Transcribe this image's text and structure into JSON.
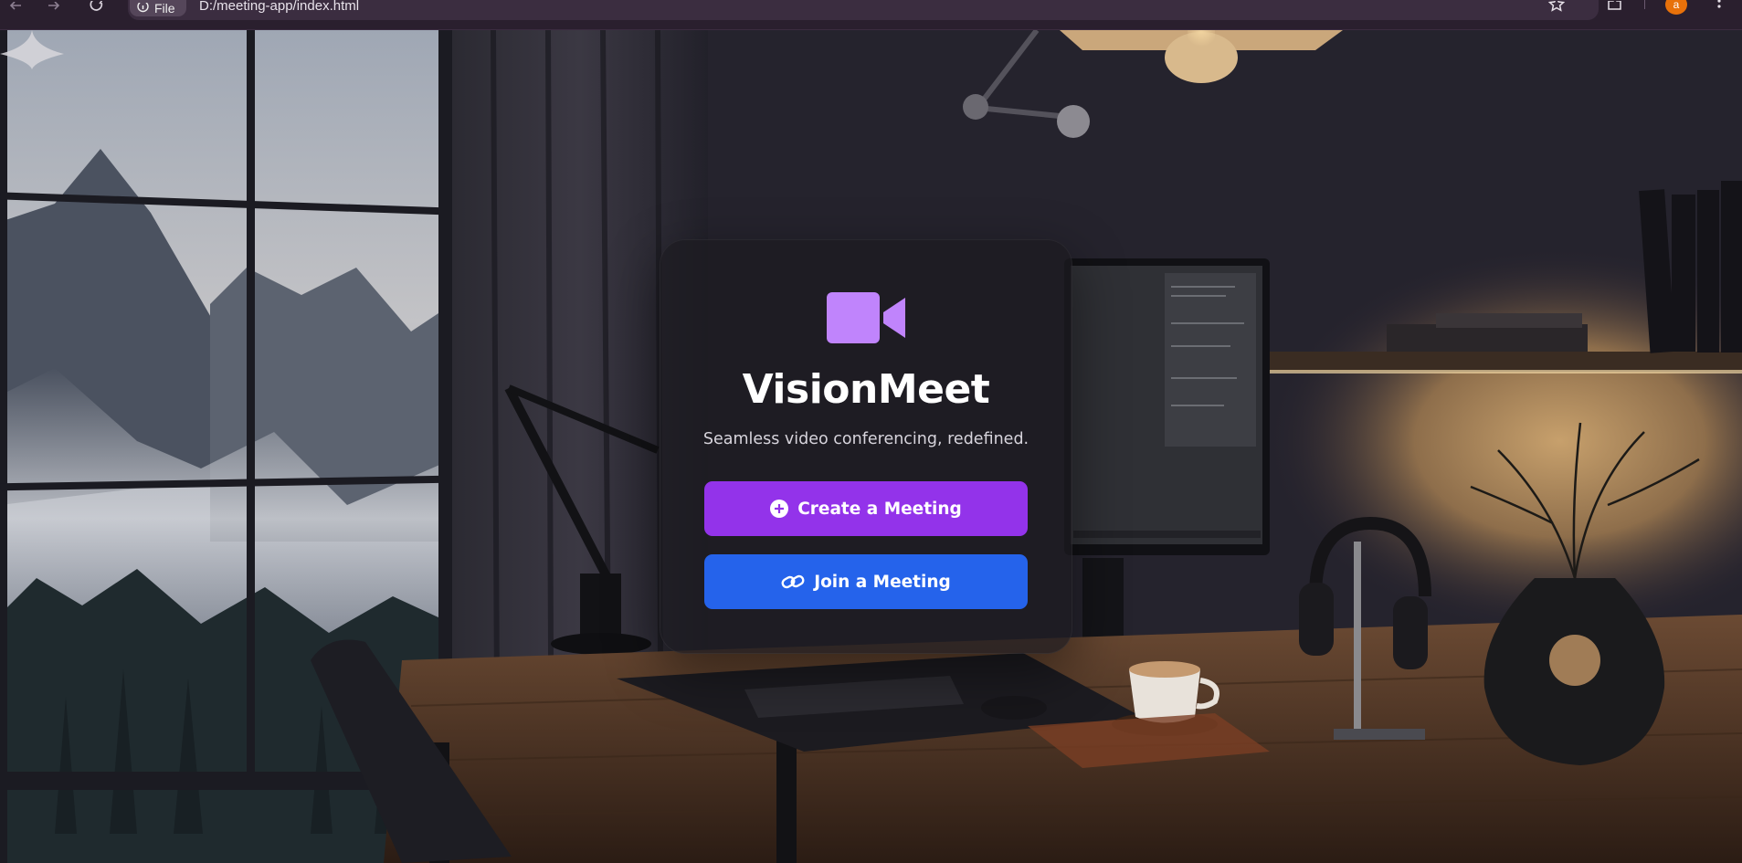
{
  "browser": {
    "site_chip_label": "File",
    "url": "D:/meeting-app/index.html",
    "profile_initial": "a",
    "nav_icons": [
      "back-arrow-icon",
      "forward-arrow-icon",
      "reload-icon"
    ],
    "toolbar_icons": [
      "info-icon",
      "star-icon",
      "extensions-icon",
      "menu-dots-icon"
    ],
    "avatar_color": "#e8710a"
  },
  "app": {
    "name": "VisionMeet",
    "tagline": "Seamless video conferencing, redefined.",
    "logo_icon": "video-camera-icon",
    "logo_color": "#c084fc",
    "buttons": {
      "create": {
        "label": "Create a Meeting",
        "icon": "plus-circle-icon",
        "color": "#9333ea"
      },
      "join": {
        "label": "Join a Meeting",
        "icon": "link-icon",
        "color": "#2563eb"
      }
    }
  }
}
